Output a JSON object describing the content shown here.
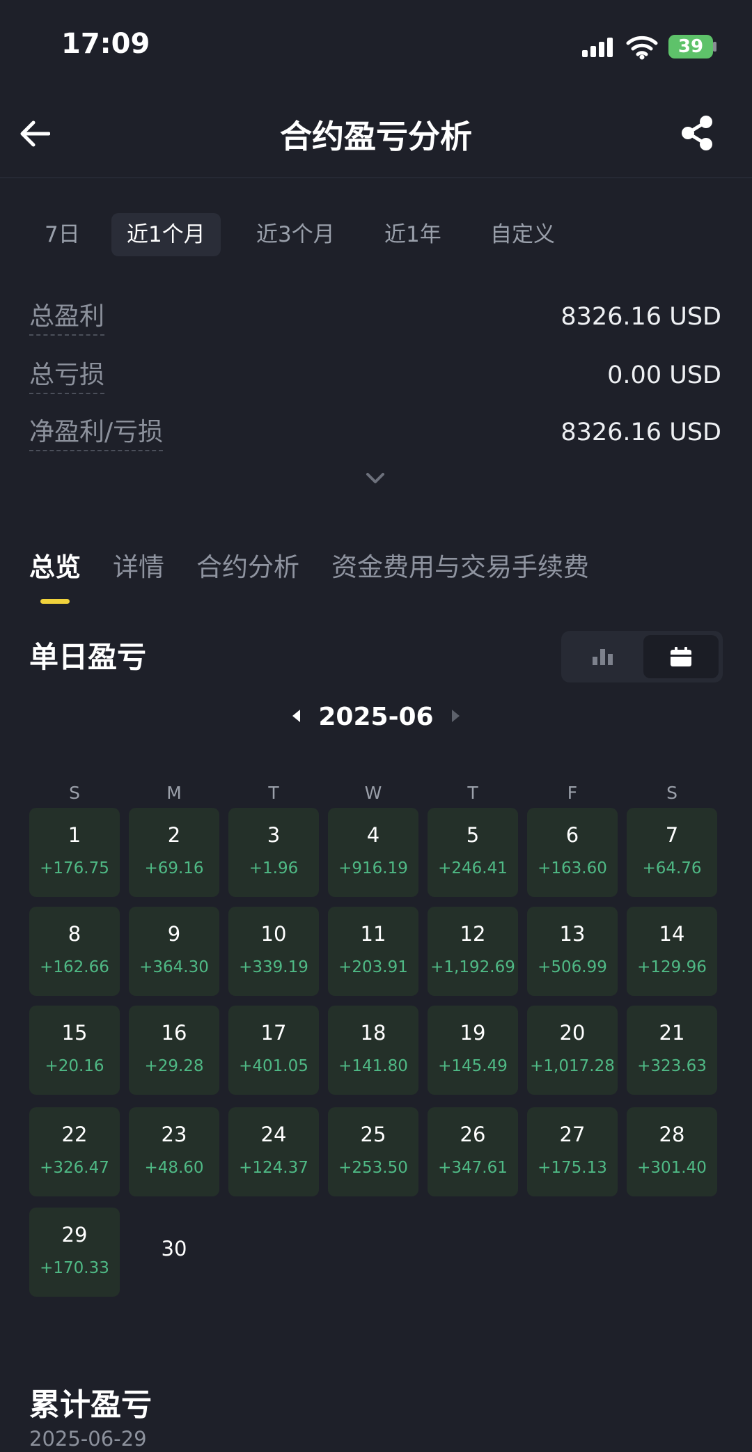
{
  "status": {
    "time": "17:09",
    "battery": "39"
  },
  "header": {
    "title": "合约盈亏分析"
  },
  "range_tabs": [
    "7日",
    "近1个月",
    "近3个月",
    "近1年",
    "自定义"
  ],
  "summary": [
    {
      "label": "总盈利",
      "value": "8326.16 USD"
    },
    {
      "label": "总亏损",
      "value": "0.00 USD"
    },
    {
      "label": "净盈利/亏损",
      "value": "8326.16 USD"
    }
  ],
  "content_tabs": [
    "总览",
    "详情",
    "合约分析",
    "资金费用与交易手续费"
  ],
  "daily": {
    "title": "单日盈亏",
    "month": "2025-06",
    "weekdays": [
      "S",
      "M",
      "T",
      "W",
      "T",
      "F",
      "S"
    ],
    "days": [
      {
        "day": "1",
        "pnl": "+176.75"
      },
      {
        "day": "2",
        "pnl": "+69.16"
      },
      {
        "day": "3",
        "pnl": "+1.96"
      },
      {
        "day": "4",
        "pnl": "+916.19"
      },
      {
        "day": "5",
        "pnl": "+246.41"
      },
      {
        "day": "6",
        "pnl": "+163.60"
      },
      {
        "day": "7",
        "pnl": "+64.76"
      },
      {
        "day": "8",
        "pnl": "+162.66"
      },
      {
        "day": "9",
        "pnl": "+364.30"
      },
      {
        "day": "10",
        "pnl": "+339.19"
      },
      {
        "day": "11",
        "pnl": "+203.91"
      },
      {
        "day": "12",
        "pnl": "+1,192.69"
      },
      {
        "day": "13",
        "pnl": "+506.99"
      },
      {
        "day": "14",
        "pnl": "+129.96"
      },
      {
        "day": "15",
        "pnl": "+20.16"
      },
      {
        "day": "16",
        "pnl": "+29.28"
      },
      {
        "day": "17",
        "pnl": "+401.05"
      },
      {
        "day": "18",
        "pnl": "+141.80"
      },
      {
        "day": "19",
        "pnl": "+145.49"
      },
      {
        "day": "20",
        "pnl": "+1,017.28"
      },
      {
        "day": "21",
        "pnl": "+323.63"
      },
      {
        "day": "22",
        "pnl": "+326.47"
      },
      {
        "day": "23",
        "pnl": "+48.60"
      },
      {
        "day": "24",
        "pnl": "+124.37"
      },
      {
        "day": "25",
        "pnl": "+253.50"
      },
      {
        "day": "26",
        "pnl": "+347.61"
      },
      {
        "day": "27",
        "pnl": "+175.13"
      },
      {
        "day": "28",
        "pnl": "+301.40"
      },
      {
        "day": "29",
        "pnl": "+170.33"
      },
      {
        "day": "30",
        "pnl": ""
      }
    ]
  },
  "cumulative": {
    "title": "累计盈亏",
    "date": "2025-06-29"
  },
  "colors": {
    "accent": "#f0d23c",
    "profit": "#4fb985",
    "cell_bg": "#243029",
    "background": "#1e2029"
  },
  "icons": [
    "back-arrow-icon",
    "share-icon",
    "chevron-down-icon",
    "bar-chart-icon",
    "calendar-icon",
    "caret-left-icon",
    "caret-right-icon"
  ]
}
